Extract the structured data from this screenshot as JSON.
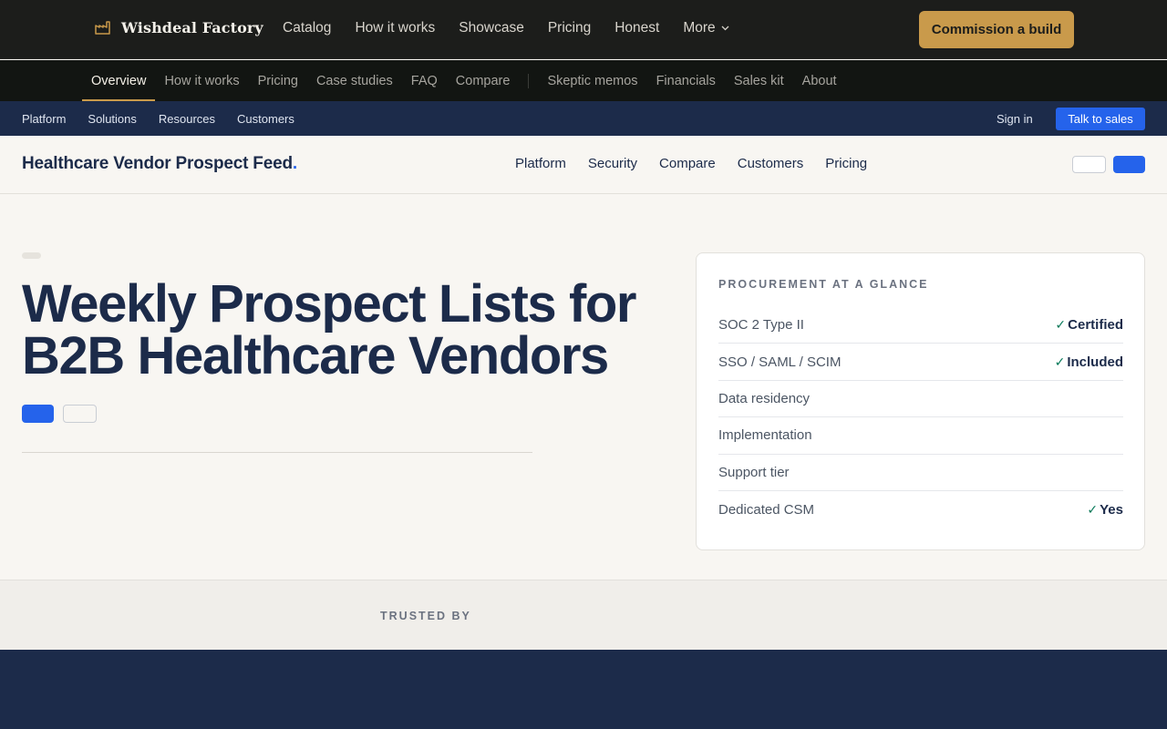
{
  "topbar": {
    "brand": "Wishdeal Factory",
    "brand_icon": "factory-icon",
    "nav": [
      "Catalog",
      "How it works",
      "Showcase",
      "Pricing",
      "Honest"
    ],
    "more_label": "More",
    "cta": "Commission a build",
    "accent_color": "#c99a4b"
  },
  "subnav": {
    "primary": [
      "Overview",
      "How it works",
      "Pricing",
      "Case studies",
      "FAQ",
      "Compare"
    ],
    "secondary": [
      "Skeptic memos",
      "Financials",
      "Sales kit",
      "About"
    ],
    "active": "Overview"
  },
  "utility": {
    "links": [
      "Platform",
      "Solutions",
      "Resources",
      "Customers"
    ],
    "signin": "Sign in",
    "cta": "Talk to sales"
  },
  "product": {
    "name": "Healthcare Vendor Prospect Feed",
    "name_dot": ".",
    "nav": [
      "Platform",
      "Security",
      "Compare",
      "Customers",
      "Pricing"
    ]
  },
  "hero": {
    "title": "Weekly Prospect Lists for B2B Healthcare Vendors"
  },
  "procurement": {
    "title": "PROCUREMENT AT A GLANCE",
    "rows": [
      {
        "label": "SOC 2 Type II",
        "value": "Certified",
        "check": true
      },
      {
        "label": "SSO / SAML / SCIM",
        "value": "Included",
        "check": true
      },
      {
        "label": "Data residency",
        "value": "",
        "check": false
      },
      {
        "label": "Implementation",
        "value": "",
        "check": false
      },
      {
        "label": "Support tier",
        "value": "",
        "check": false
      },
      {
        "label": "Dedicated CSM",
        "value": "Yes",
        "check": true
      }
    ],
    "check_glyph": "✓"
  },
  "trusted": {
    "label": "TRUSTED BY"
  }
}
